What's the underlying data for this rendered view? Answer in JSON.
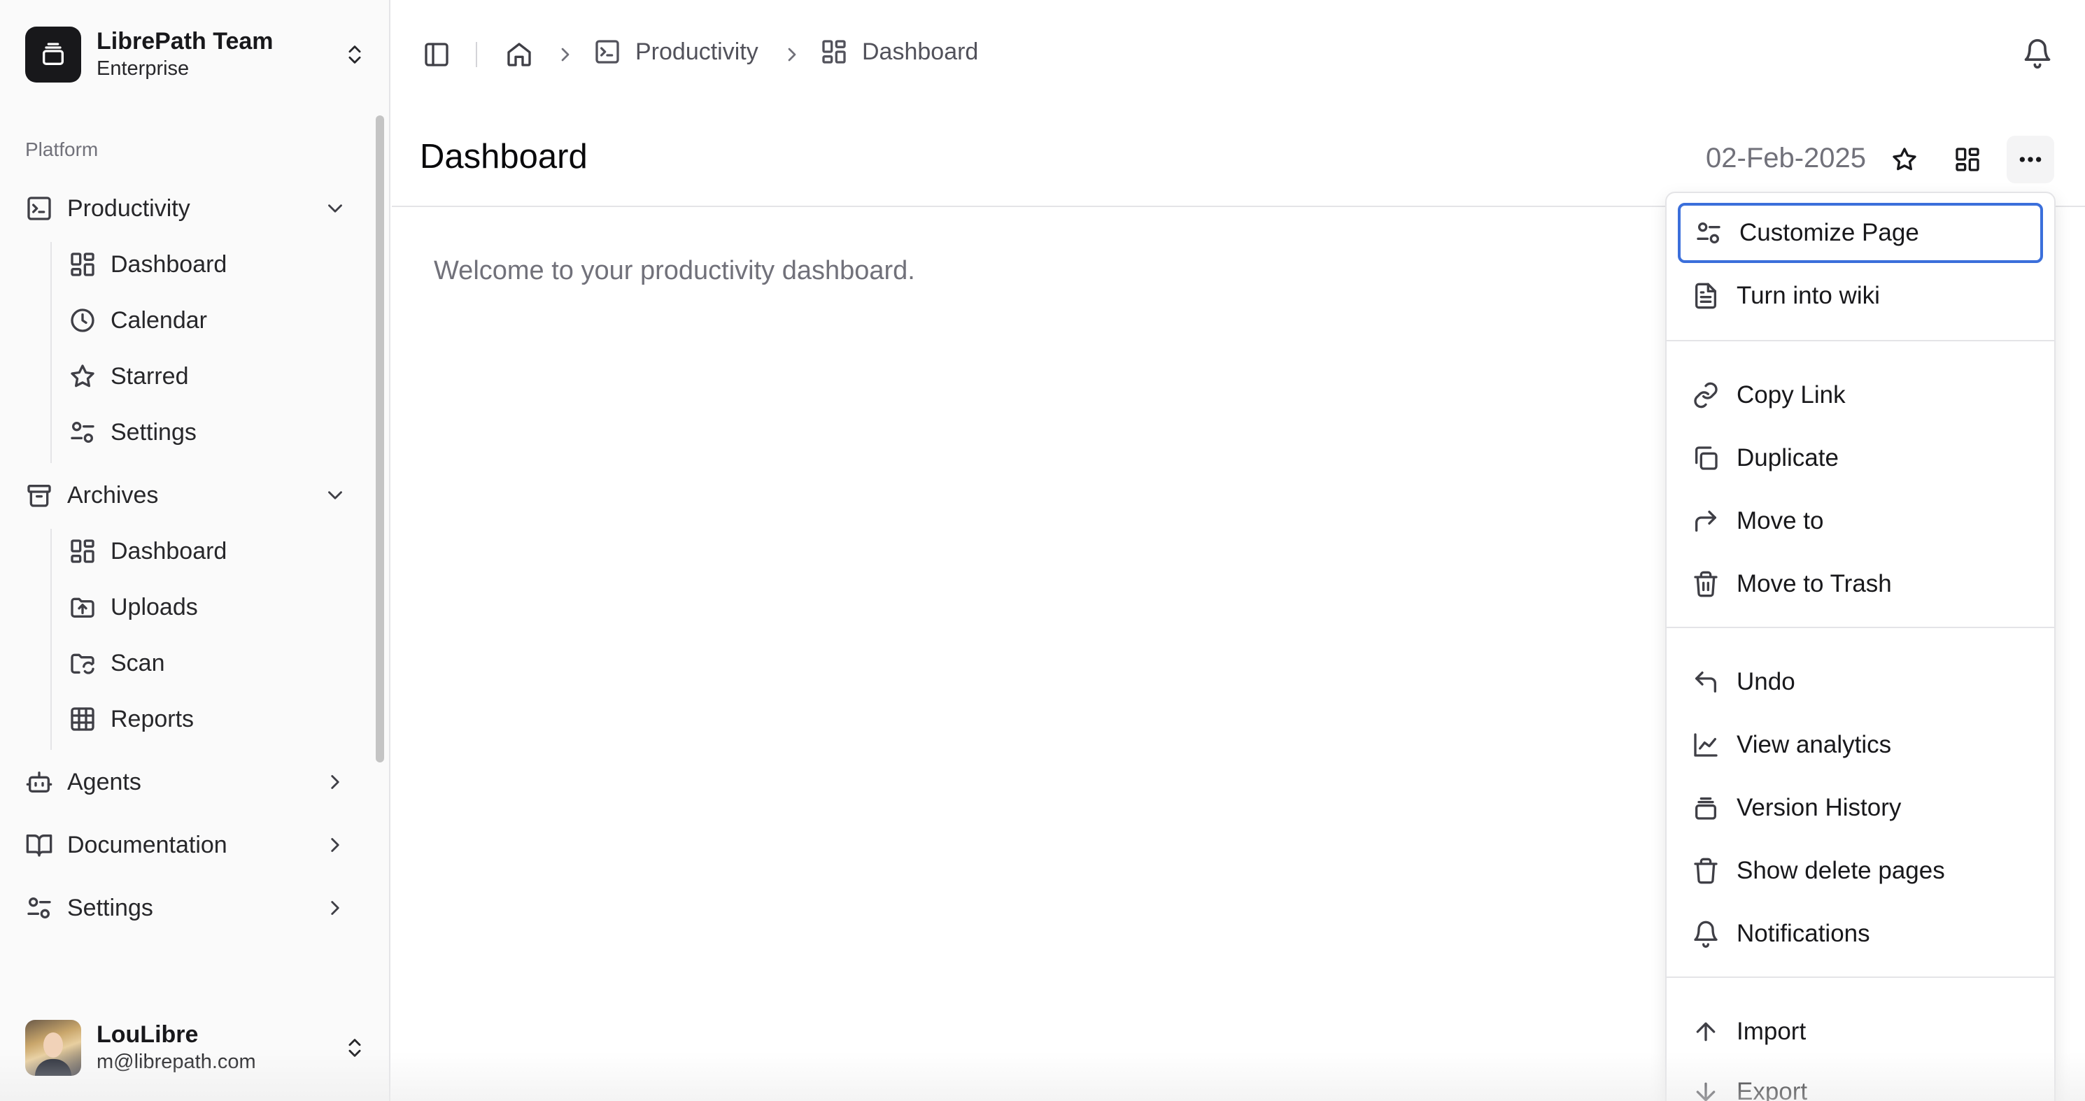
{
  "team": {
    "name": "LibrePath Team",
    "plan": "Enterprise"
  },
  "sidebar": {
    "group_label": "Platform",
    "productivity": {
      "label": "Productivity",
      "items": [
        {
          "label": "Dashboard",
          "icon": "dashboard-icon"
        },
        {
          "label": "Calendar",
          "icon": "clock-icon"
        },
        {
          "label": "Starred",
          "icon": "star-icon"
        },
        {
          "label": "Settings",
          "icon": "settings-sliders-icon"
        }
      ]
    },
    "archives": {
      "label": "Archives",
      "items": [
        {
          "label": "Dashboard",
          "icon": "dashboard-icon"
        },
        {
          "label": "Uploads",
          "icon": "folder-upload-icon"
        },
        {
          "label": "Scan",
          "icon": "folder-sync-icon"
        },
        {
          "label": "Reports",
          "icon": "table-grid-icon"
        }
      ]
    },
    "agents": {
      "label": "Agents"
    },
    "documentation": {
      "label": "Documentation"
    },
    "settings": {
      "label": "Settings"
    }
  },
  "user": {
    "name": "LouLibre",
    "email": "m@librepath.com"
  },
  "breadcrumb": {
    "section": "Productivity",
    "page": "Dashboard"
  },
  "page": {
    "title": "Dashboard",
    "date": "02-Feb-2025",
    "welcome": "Welcome to your productivity dashboard."
  },
  "menu": {
    "customize": "Customize Page",
    "wiki": "Turn into wiki",
    "copy_link": "Copy Link",
    "duplicate": "Duplicate",
    "move_to": "Move to",
    "trash": "Move to Trash",
    "undo": "Undo",
    "analytics": "View analytics",
    "history": "Version History",
    "show_deleted": "Show delete pages",
    "notifications": "Notifications",
    "import": "Import",
    "export": "Export"
  },
  "colors": {
    "focus_ring": "#3b6fdb",
    "logo_bg": "#18181b"
  }
}
